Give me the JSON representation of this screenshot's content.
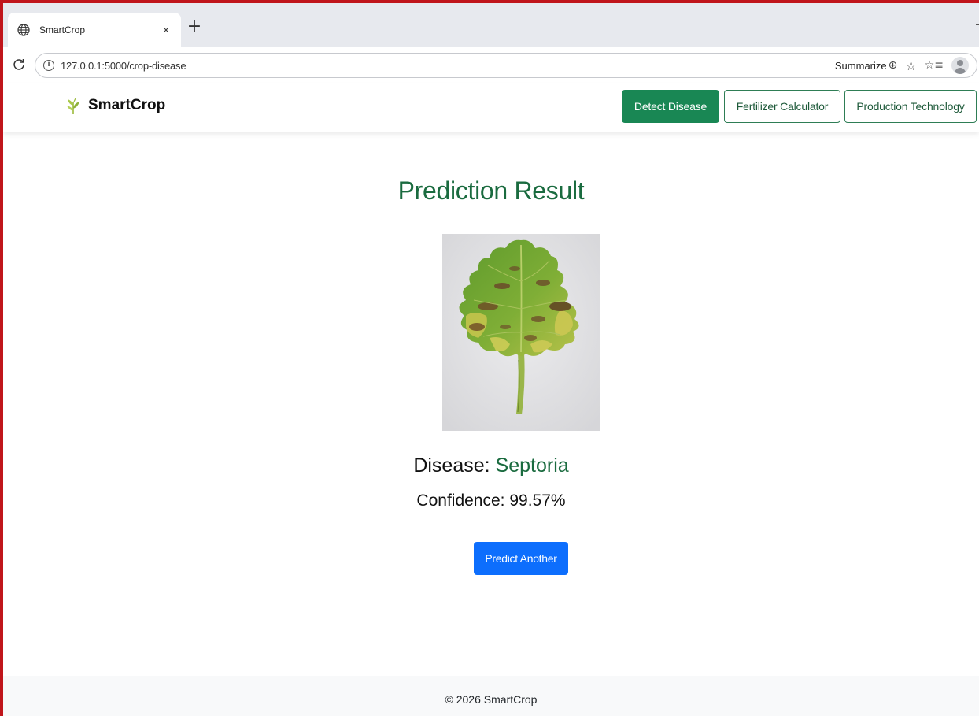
{
  "browser": {
    "tab_title": "SmartCrop",
    "tab_close": "×",
    "new_tab": "+",
    "url": "127.0.0.1:5000/crop-disease",
    "summarize_label": "Summarize",
    "icons": [
      "globe-icon",
      "close-icon",
      "plus-icon",
      "reload-icon",
      "info-icon",
      "copilot-icon",
      "star-icon",
      "favorites-icon",
      "profile-icon"
    ]
  },
  "navbar": {
    "brand": "SmartCrop",
    "brand_icon": "wheat-sprout-icon",
    "links": [
      {
        "label": "Detect Disease",
        "active": true
      },
      {
        "label": "Fertilizer Calculator",
        "active": false
      },
      {
        "label": "Production Technology",
        "active": false
      }
    ]
  },
  "result": {
    "title": "Prediction Result",
    "disease_label": "Disease:",
    "disease_value": "Septoria",
    "confidence_label": "Confidence:",
    "confidence_value": "99.57%",
    "predict_button": "Predict Another"
  },
  "footer": {
    "text": "© 2026 SmartCrop"
  },
  "colors": {
    "brand_green": "#198754",
    "title_green": "#1a6b3f",
    "primary_blue": "#0d6efd",
    "frame_red": "#c0151b"
  }
}
